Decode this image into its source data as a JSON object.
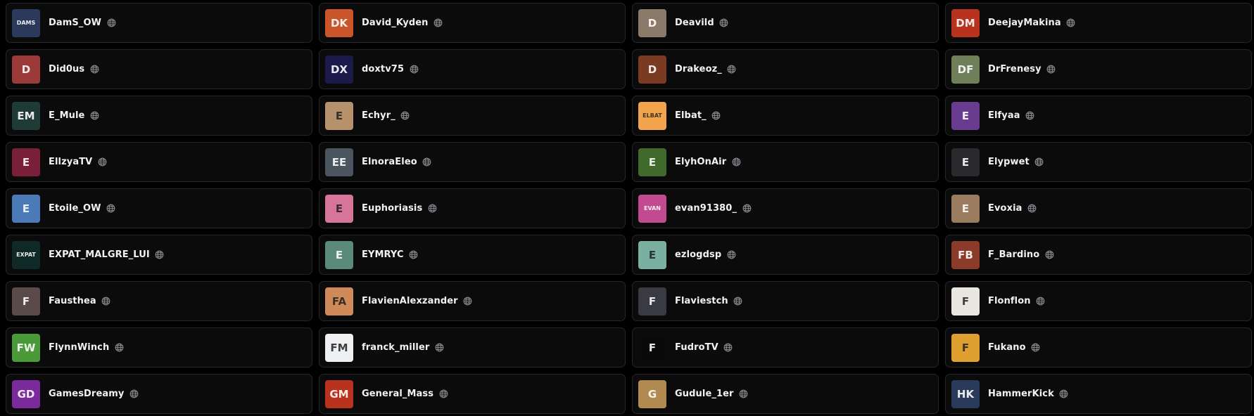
{
  "channels": [
    {
      "name": "DamS_OW",
      "initials": "DAMS",
      "color": "#2b3a5c"
    },
    {
      "name": "David_Kyden",
      "initials": "DK",
      "color": "#c9552a"
    },
    {
      "name": "Deavild",
      "initials": "D",
      "color": "#8a7a6a"
    },
    {
      "name": "DeejayMakina",
      "initials": "DM",
      "color": "#b8321e"
    },
    {
      "name": "Did0us",
      "initials": "D",
      "color": "#9c3a3a"
    },
    {
      "name": "doxtv75",
      "initials": "DX",
      "color": "#1b1a4a"
    },
    {
      "name": "Drakeoz_",
      "initials": "D",
      "color": "#7a3b22"
    },
    {
      "name": "DrFrenesy",
      "initials": "DF",
      "color": "#6f7f5a"
    },
    {
      "name": "E_Mule",
      "initials": "EM",
      "color": "#1f3b36"
    },
    {
      "name": "Echyr_",
      "initials": "E",
      "color": "#b5916c"
    },
    {
      "name": "Elbat_",
      "initials": "ELBAT",
      "color": "#f2a44d"
    },
    {
      "name": "Elfyaa",
      "initials": "E",
      "color": "#6a3c8f"
    },
    {
      "name": "EllzyaTV",
      "initials": "E",
      "color": "#7a1f3a"
    },
    {
      "name": "ElnoraEleo",
      "initials": "EE",
      "color": "#4b5560"
    },
    {
      "name": "ElyhOnAir",
      "initials": "E",
      "color": "#3f6a2c"
    },
    {
      "name": "Elypwet",
      "initials": "E",
      "color": "#2a2a2e"
    },
    {
      "name": "Etoile_OW",
      "initials": "E",
      "color": "#4a7bb8"
    },
    {
      "name": "Euphoriasis",
      "initials": "E",
      "color": "#d6749a"
    },
    {
      "name": "evan91380_",
      "initials": "EVAN",
      "color": "#c24a8f"
    },
    {
      "name": "Evoxia",
      "initials": "E",
      "color": "#9a7b60"
    },
    {
      "name": "EXPAT_MALGRE_LUI",
      "initials": "EXPAT",
      "color": "#0f2a26"
    },
    {
      "name": "EYMRYC",
      "initials": "E",
      "color": "#5a8a7a"
    },
    {
      "name": "ezlogdsp",
      "initials": "E",
      "color": "#7ab0a0"
    },
    {
      "name": "F_Bardino",
      "initials": "FB",
      "color": "#8a3b2a"
    },
    {
      "name": "Fausthea",
      "initials": "F",
      "color": "#5a4a4a"
    },
    {
      "name": "FlavienAlexzander",
      "initials": "FA",
      "color": "#d08a5a"
    },
    {
      "name": "Flaviestch",
      "initials": "F",
      "color": "#3a3a44"
    },
    {
      "name": "Flonflon",
      "initials": "F",
      "color": "#e9e6e0"
    },
    {
      "name": "FlynnWinch",
      "initials": "FW",
      "color": "#4a9a3a"
    },
    {
      "name": "franck_miller",
      "initials": "FM",
      "color": "#eef0f2"
    },
    {
      "name": "FudroTV",
      "initials": "F",
      "color": "#0a0a0a"
    },
    {
      "name": "Fukano",
      "initials": "F",
      "color": "#e0a030"
    },
    {
      "name": "GamesDreamy",
      "initials": "GD",
      "color": "#7a2a9a"
    },
    {
      "name": "General_Mass",
      "initials": "GM",
      "color": "#b8321e"
    },
    {
      "name": "Gudule_1er",
      "initials": "G",
      "color": "#b08a50"
    },
    {
      "name": "HammerKick",
      "initials": "HK",
      "color": "#2a3a5a"
    }
  ]
}
